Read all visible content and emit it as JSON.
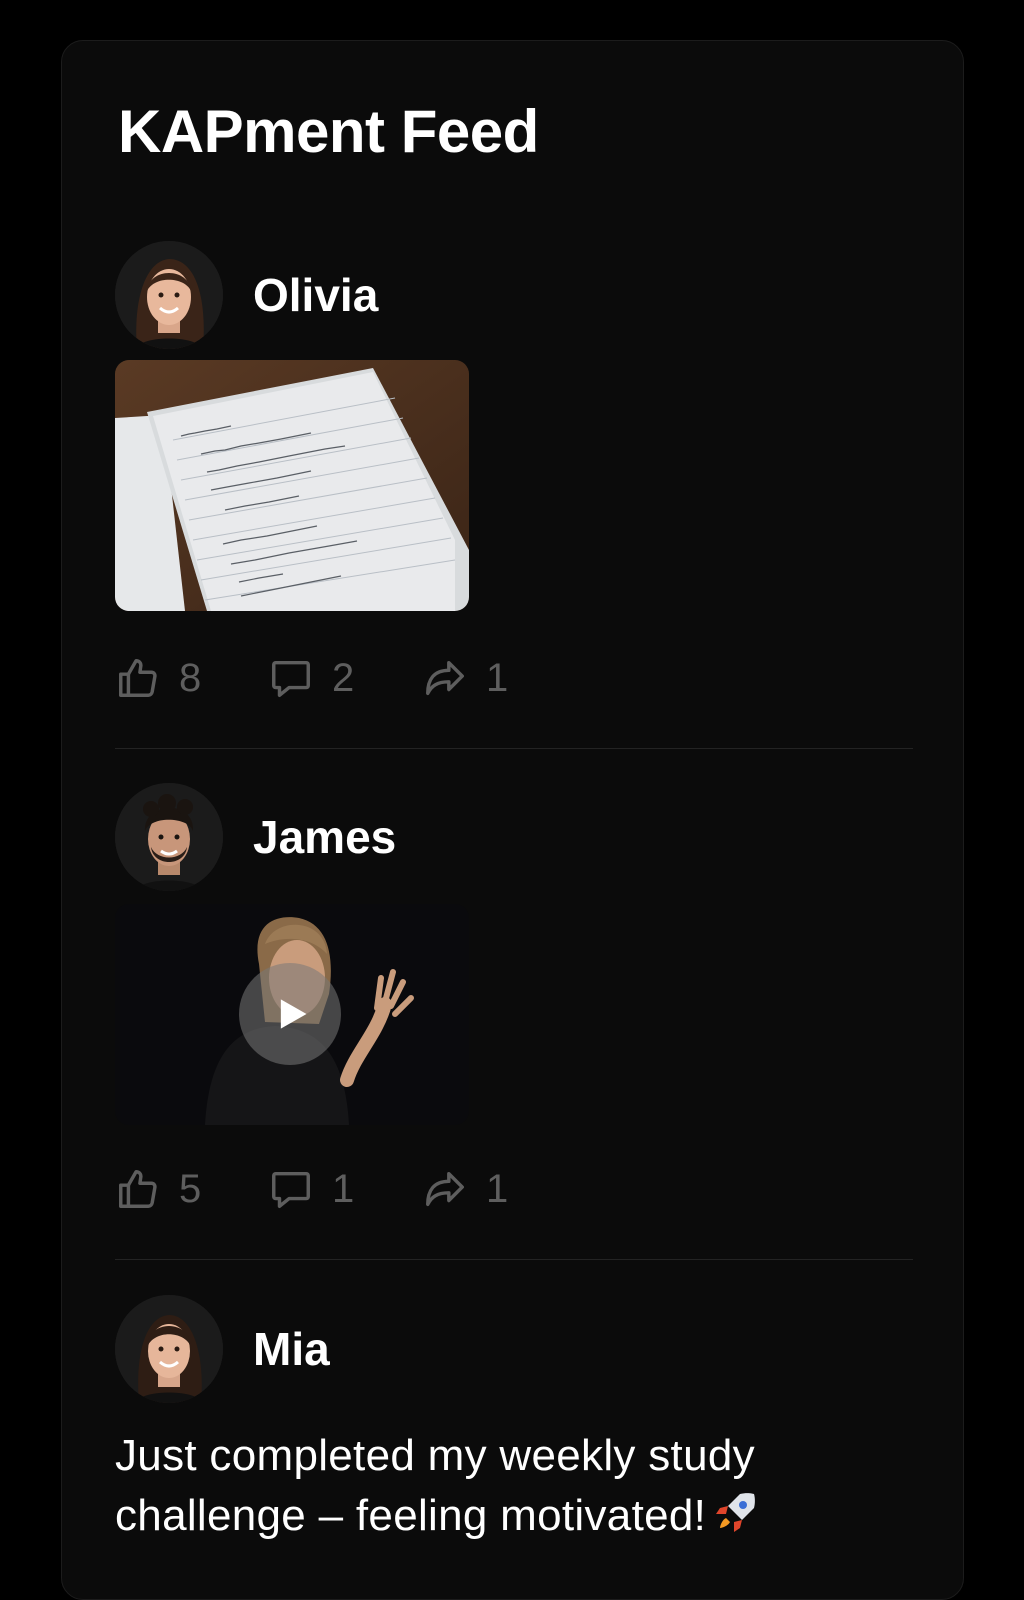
{
  "feed": {
    "title": "KAPment Feed"
  },
  "posts": [
    {
      "author": "Olivia",
      "media": {
        "type": "image",
        "subject": "notebook-photo"
      },
      "likes": "8",
      "comments": "2",
      "shares": "1"
    },
    {
      "author": "James",
      "media": {
        "type": "video",
        "subject": "woman-waving-video"
      },
      "likes": "5",
      "comments": "1",
      "shares": "1"
    },
    {
      "author": "Mia",
      "text": "Just completed my weekly study challenge – feeling motivated!",
      "emoji": "rocket"
    }
  ],
  "icons": {
    "like": "thumbs-up-icon",
    "comment": "comment-bubble-icon",
    "share": "share-arrow-icon",
    "play": "play-icon"
  },
  "colors": {
    "background": "#000000",
    "card": "#0b0b0b",
    "muted": "#5e5e5e",
    "text": "#ffffff"
  }
}
